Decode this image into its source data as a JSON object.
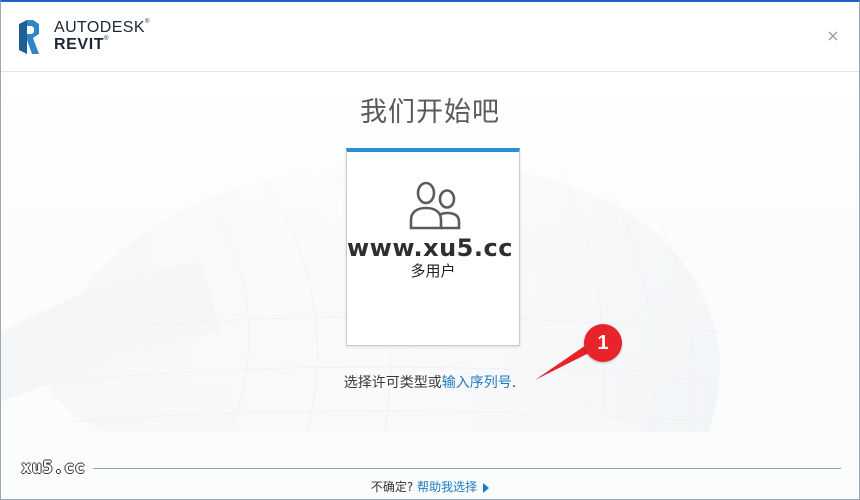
{
  "header": {
    "brand_line1": "AUTODESK",
    "brand_line2": "REVIT",
    "logo_letter": "R",
    "close_glyph": "×"
  },
  "main": {
    "title": "我们开始吧",
    "card": {
      "icon": "users-icon",
      "label": "多用户"
    },
    "license_text": "选择许可类型或",
    "license_link": "输入序列号",
    "license_period": "."
  },
  "annotation": {
    "badge": "1"
  },
  "watermarks": {
    "center": "www.xu5.cc",
    "corner": "xu5.cc"
  },
  "footer": {
    "question": "不确定?",
    "help_link": "帮助我选择"
  },
  "colors": {
    "accent_blue": "#2a8fd6",
    "link_blue": "#1a7ac2",
    "annotation_red": "#e8232b",
    "window_border": "#1e64c8"
  }
}
